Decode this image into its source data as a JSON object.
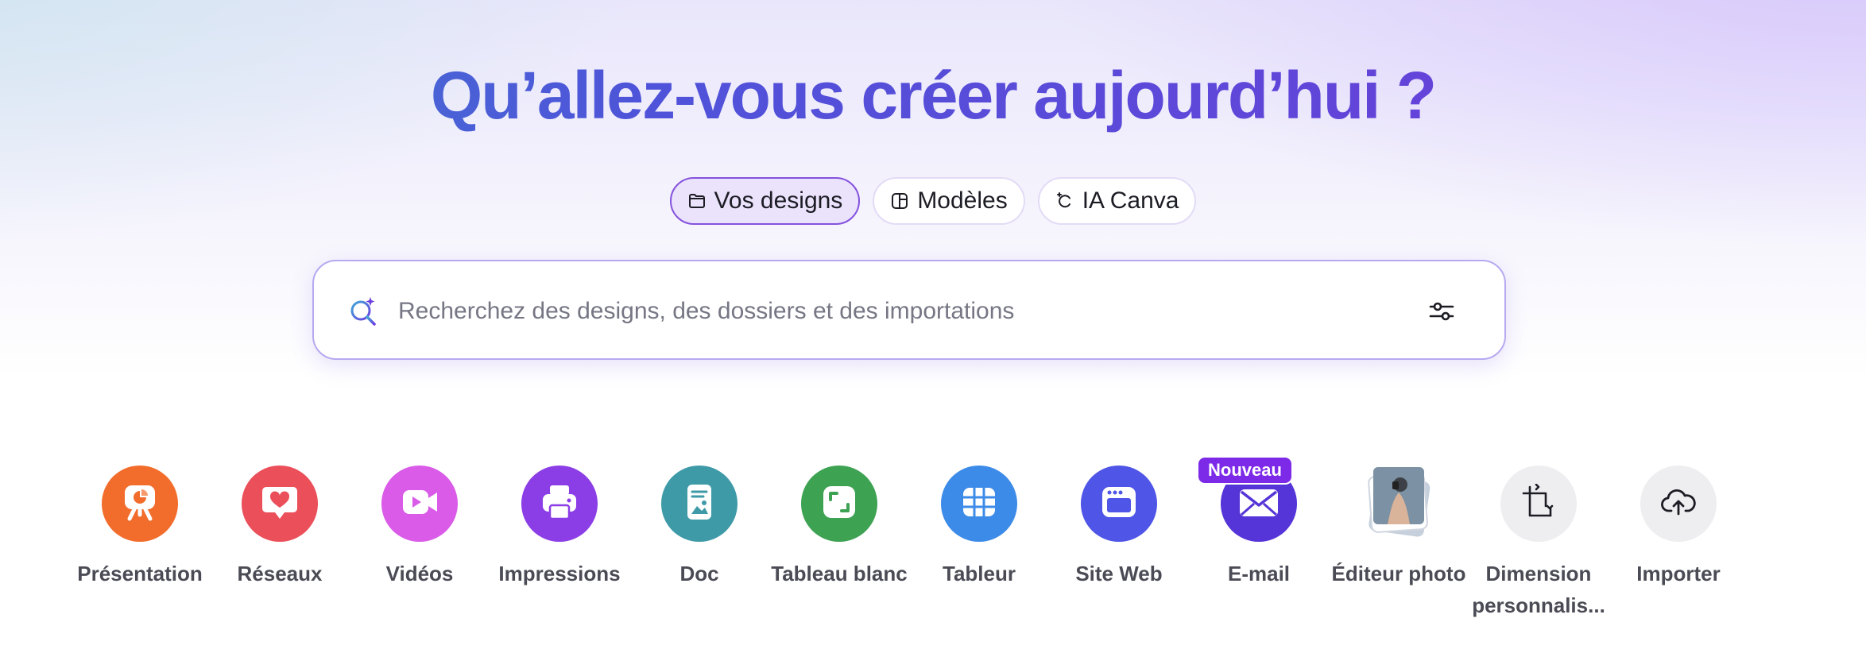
{
  "hero": {
    "title": "Qu’allez-vous créer aujourd’hui ?"
  },
  "tabs": [
    {
      "label": "Vos designs",
      "icon": "folder-icon",
      "active": true
    },
    {
      "label": "Modèles",
      "icon": "template-icon",
      "active": false
    },
    {
      "label": "IA Canva",
      "icon": "canva-ai-icon",
      "active": false
    }
  ],
  "search": {
    "placeholder": "Recherchez des designs, des dossiers et des importations",
    "value": ""
  },
  "categories": [
    {
      "label": "Présentation",
      "icon": "presentation-icon",
      "color": "#f26d2c"
    },
    {
      "label": "Réseaux",
      "icon": "heart-chat-icon",
      "color": "#ea4f5a"
    },
    {
      "label": "Vidéos",
      "icon": "video-camera-icon",
      "color": "#d95be8"
    },
    {
      "label": "Impressions",
      "icon": "printer-icon",
      "color": "#8c3ee6"
    },
    {
      "label": "Doc",
      "icon": "doc-icon",
      "color": "#3f9aa8"
    },
    {
      "label": "Tableau blanc",
      "icon": "whiteboard-icon",
      "color": "#3ea253"
    },
    {
      "label": "Tableur",
      "icon": "sheet-icon",
      "color": "#3d8be8"
    },
    {
      "label": "Site Web",
      "icon": "website-icon",
      "color": "#4f55e6"
    },
    {
      "label": "E-mail",
      "icon": "envelope-icon",
      "color": "#5534d8",
      "badge": "Nouveau"
    },
    {
      "label": "Éditeur photo",
      "icon": "photo-stack-icon",
      "color": "#aeb9c2"
    },
    {
      "label": "Dimension personnalis...",
      "icon": "resize-icon",
      "color": "#eeeef1"
    },
    {
      "label": "Importer",
      "icon": "cloud-upload-icon",
      "color": "#eeeef1"
    }
  ]
}
